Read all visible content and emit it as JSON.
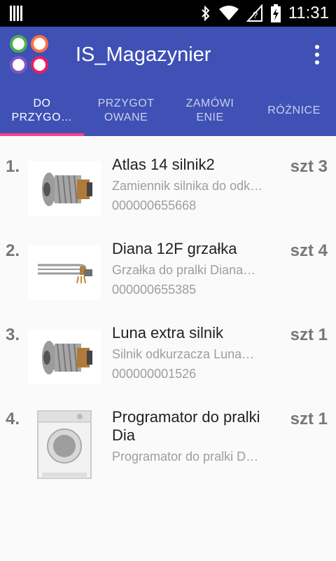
{
  "status_bar": {
    "time": "11:31",
    "icons": [
      "bluetooth-icon",
      "wifi-icon",
      "no-sim-icon",
      "battery-charging-icon"
    ]
  },
  "app_bar": {
    "title": "IS_Magazynier",
    "logo_colors": [
      "#4caf50",
      "#ff7043",
      "#7e57c2",
      "#e91e63"
    ],
    "overflow_icon": "more-vert-icon"
  },
  "colors": {
    "primary": "#3f51b5",
    "accent": "#ff4081"
  },
  "tabs": [
    {
      "label": "DO PRZYGO…",
      "active": true
    },
    {
      "label": "PRZYGOT OWANE",
      "active": false
    },
    {
      "label": "ZAMÓWI ENIE",
      "active": false
    },
    {
      "label": "RÓŻNICE",
      "active": false
    }
  ],
  "items": [
    {
      "index": "1.",
      "name": "Atlas 14 silnik2",
      "description": "Zamiennik silnika do odk…",
      "code": "000000655668",
      "qty": "szt 3",
      "image": "motor"
    },
    {
      "index": "2.",
      "name": "Diana 12F grzałka",
      "description": "Grzałka do pralki Diana…",
      "code": "000000655385",
      "qty": "szt 4",
      "image": "heater"
    },
    {
      "index": "3.",
      "name": "Luna extra silnik",
      "description": "Silnik odkurzacza Luna…",
      "code": "000000001526",
      "qty": "szt 1",
      "image": "motor"
    },
    {
      "index": "4.",
      "name": "Programator do pralki Dia",
      "description": "Programator do pralki D…",
      "code": "",
      "qty": "szt 1",
      "image": "washer"
    }
  ]
}
